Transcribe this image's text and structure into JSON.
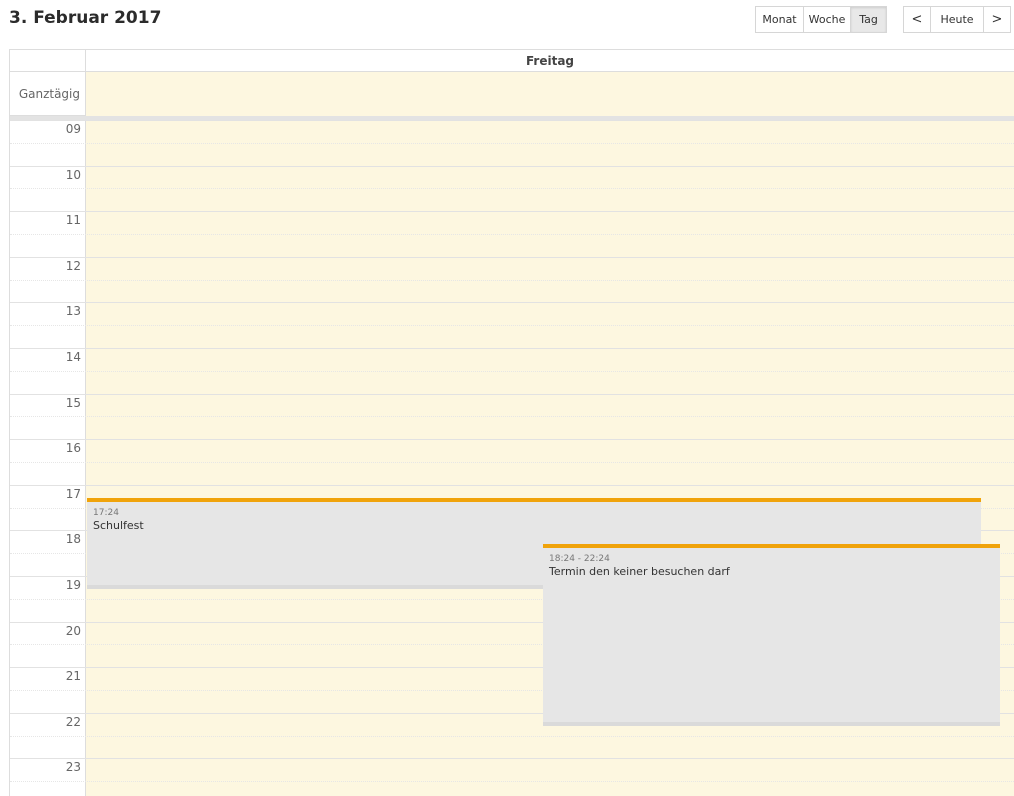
{
  "header": {
    "title": "3. Februar 2017",
    "views": [
      "Monat",
      "Woche",
      "Tag"
    ],
    "active_view": "Tag",
    "nav": {
      "prev": "<",
      "today": "Heute",
      "next": ">"
    }
  },
  "calendar": {
    "day_name": "Freitag",
    "allday_label": "Ganztägig",
    "hours": [
      "09",
      "10",
      "11",
      "12",
      "13",
      "14",
      "15",
      "16",
      "17",
      "18",
      "19",
      "20",
      "21",
      "22",
      "23"
    ],
    "day_bg_color": "#fdf7e0",
    "event_accent_color": "#f0a30a"
  },
  "events": [
    {
      "time": "17:24",
      "title": "Schulfest"
    },
    {
      "time": "18:24 - 22:24",
      "title": "Termin den keiner besuchen darf"
    }
  ]
}
